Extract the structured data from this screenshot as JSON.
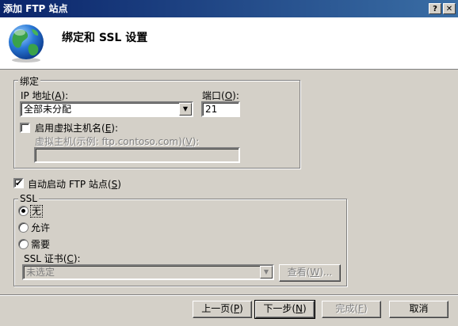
{
  "window": {
    "title": "添加 FTP 站点",
    "help_btn": "?",
    "close_btn": "✕"
  },
  "header": {
    "title": "绑定和 SSL 设置",
    "icon": "globe-icon"
  },
  "binding": {
    "legend": "绑定",
    "ip_label_pre": "IP 地址(",
    "ip_label_key": "A",
    "ip_label_post": "):",
    "ip_value": "全部未分配",
    "port_label_pre": "端口(",
    "port_label_key": "O",
    "port_label_post": "):",
    "port_value": "21",
    "vhost_enable_pre": "启用虚拟主机名(",
    "vhost_enable_key": "E",
    "vhost_enable_post": "):",
    "vhost_enable_checked": false,
    "vhost_label_pre": "虚拟主机(示例: ftp.contoso.com)(",
    "vhost_label_key": "V",
    "vhost_label_post": "):",
    "vhost_value": ""
  },
  "autostart": {
    "label_pre": "自动启动 FTP 站点(",
    "label_key": "S",
    "label_post": ")",
    "checked": true
  },
  "ssl": {
    "legend": "SSL",
    "options": [
      {
        "label": "无",
        "checked": true
      },
      {
        "label": "允许",
        "checked": false
      },
      {
        "label": "需要",
        "checked": false
      }
    ],
    "cert_label_pre": "SSL 证书(",
    "cert_label_key": "C",
    "cert_label_post": "):",
    "cert_value": "未选定",
    "view_pre": "查看(",
    "view_key": "W",
    "view_post": ")..."
  },
  "footer": {
    "prev_pre": "上一页(",
    "prev_key": "P",
    "prev_post": ")",
    "next_pre": "下一步(",
    "next_key": "N",
    "next_post": ")",
    "finish_pre": "完成(",
    "finish_key": "F",
    "finish_post": ")",
    "cancel": "取消"
  }
}
